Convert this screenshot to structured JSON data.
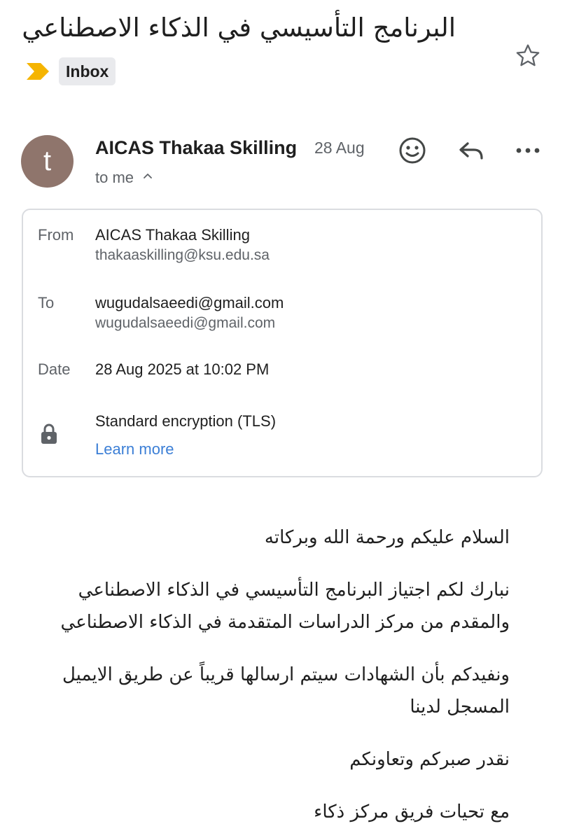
{
  "subject": "البرنامج التأسيسي في الذكاء الاصطناعي",
  "label": {
    "icon": "important-marker-icon",
    "text": "Inbox",
    "color": "#f5b400"
  },
  "header": {
    "avatar_letter": "t",
    "avatar_color": "#8f756c",
    "sender_name": "AICAS Thakaa Skilling",
    "date": "28 Aug",
    "recipient": "to me",
    "actions": [
      "emoji-reaction-icon",
      "reply-icon",
      "more-options-icon"
    ]
  },
  "details": {
    "from_label": "From",
    "from_name": "AICAS Thakaa Skilling",
    "from_email": "thakaaskilling@ksu.edu.sa",
    "to_label": "To",
    "to_name": "wugudalsaeedi@gmail.com",
    "to_email": "wugudalsaeedi@gmail.com",
    "date_label": "Date",
    "date_value": "28 Aug 2025 at 10:02 PM",
    "encryption": "Standard encryption (TLS)",
    "learn_more": "Learn more",
    "link_color": "#3c7fd6"
  },
  "body": [
    [
      "السلام عليكم ورحمة الله وبركاته"
    ],
    [
      "نبارك لكم اجتياز البرنامج التأسيسي في الذكاء الاصطناعي",
      "والمقدم من مركز الدراسات المتقدمة في الذكاء الاصطناعي"
    ],
    [
      "ونفيدكم بأن الشهادات سيتم ارسالها قريباً عن طريق الايميل",
      "المسجل لدينا"
    ],
    [
      "نقدر صبركم وتعاونكم"
    ],
    [
      "مع تحيات فريق مركز ذكاء"
    ]
  ]
}
